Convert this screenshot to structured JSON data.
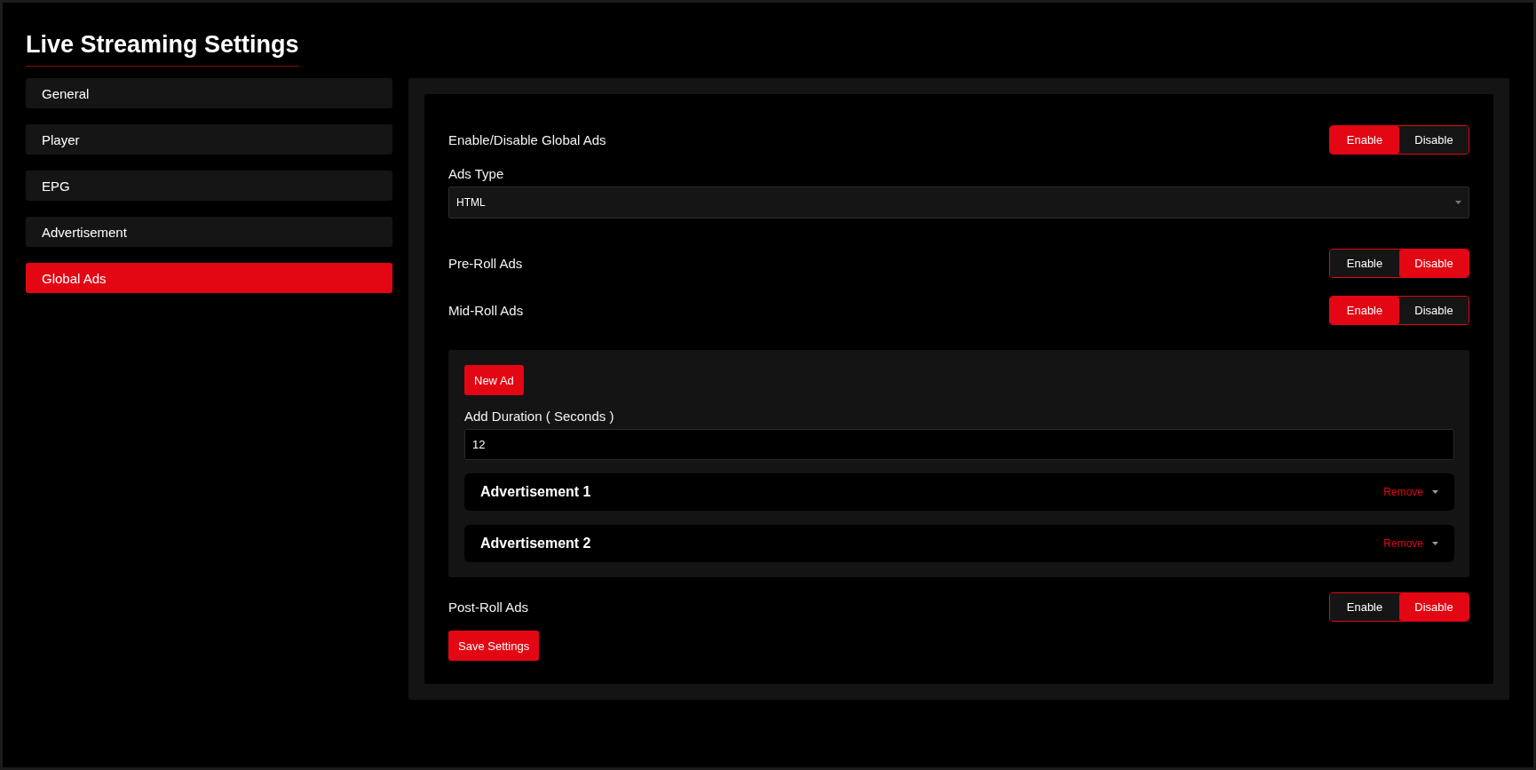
{
  "title": "Live Streaming Settings",
  "sidebar": {
    "items": [
      {
        "label": "General",
        "selected": false
      },
      {
        "label": "Player",
        "selected": false
      },
      {
        "label": "EPG",
        "selected": false
      },
      {
        "label": "Advertisement",
        "selected": false
      },
      {
        "label": "Global Ads",
        "selected": true
      }
    ]
  },
  "settings": [
    {
      "kind": "toggle",
      "label": "Enable/Disable Global Ads",
      "options": [
        {
          "label": "Enable",
          "selected": true
        },
        {
          "label": "Disable",
          "selected": false
        }
      ]
    },
    {
      "kind": "select",
      "label": "Ads Type",
      "value": "HTML"
    },
    {
      "kind": "toggle",
      "label": "Pre-Roll Ads",
      "options": [
        {
          "label": "Enable",
          "selected": false
        },
        {
          "label": "Disable",
          "selected": true
        }
      ]
    },
    {
      "kind": "toggle",
      "label": "Mid-Roll Ads",
      "options": [
        {
          "label": "Enable",
          "selected": true
        },
        {
          "label": "Disable",
          "selected": false
        }
      ]
    },
    {
      "kind": "ads_panel",
      "new_button": "New Ad",
      "duration_label": "Add Duration ( Seconds )",
      "duration_value": "12",
      "ads": [
        {
          "title": "Advertisement 1",
          "action": "Remove"
        },
        {
          "title": "Advertisement 2",
          "action": "Remove"
        }
      ]
    },
    {
      "kind": "toggle",
      "label": "Post-Roll Ads",
      "options": [
        {
          "label": "Enable",
          "selected": false
        },
        {
          "label": "Disable",
          "selected": true
        }
      ]
    }
  ],
  "save_button": "Save Settings"
}
